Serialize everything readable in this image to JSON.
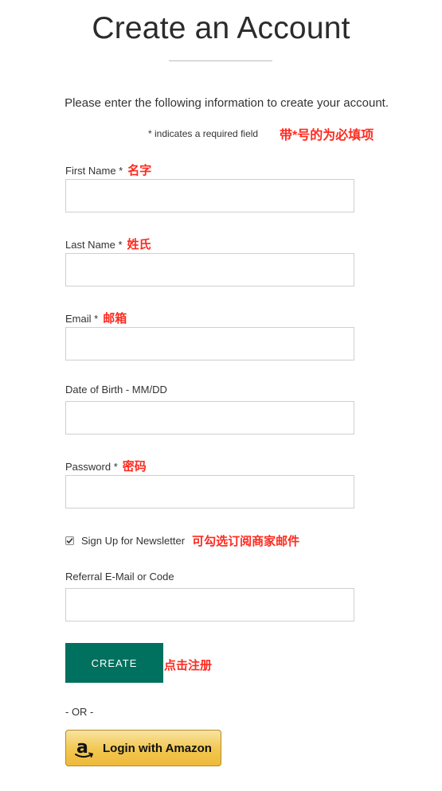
{
  "page": {
    "title": "Create an Account",
    "intro": "Please enter the following information to create your account.",
    "required_note": "* indicates a required field"
  },
  "annotations": {
    "required": "带*号的为必填项",
    "first_name": "名字",
    "last_name": "姓氏",
    "email": "邮箱",
    "password": "密码",
    "newsletter": "可勾选订阅商家邮件",
    "create": "点击注册",
    "color": "#ff2a1f"
  },
  "form": {
    "first_name": {
      "label": "First Name *",
      "value": ""
    },
    "last_name": {
      "label": "Last Name *",
      "value": ""
    },
    "email": {
      "label": "Email *",
      "value": ""
    },
    "dob": {
      "label": "Date of Birth - MM/DD",
      "value": ""
    },
    "password": {
      "label": "Password *",
      "value": ""
    },
    "newsletter": {
      "label": "Sign Up for Newsletter",
      "checked": true
    },
    "referral": {
      "label": "Referral E-Mail or Code",
      "value": ""
    }
  },
  "actions": {
    "create_label": "CREATE",
    "create_color": "#00705f",
    "or_label": "- OR -",
    "amazon_label": "Login with Amazon",
    "amazon_icon": "amazon-logo-icon"
  }
}
